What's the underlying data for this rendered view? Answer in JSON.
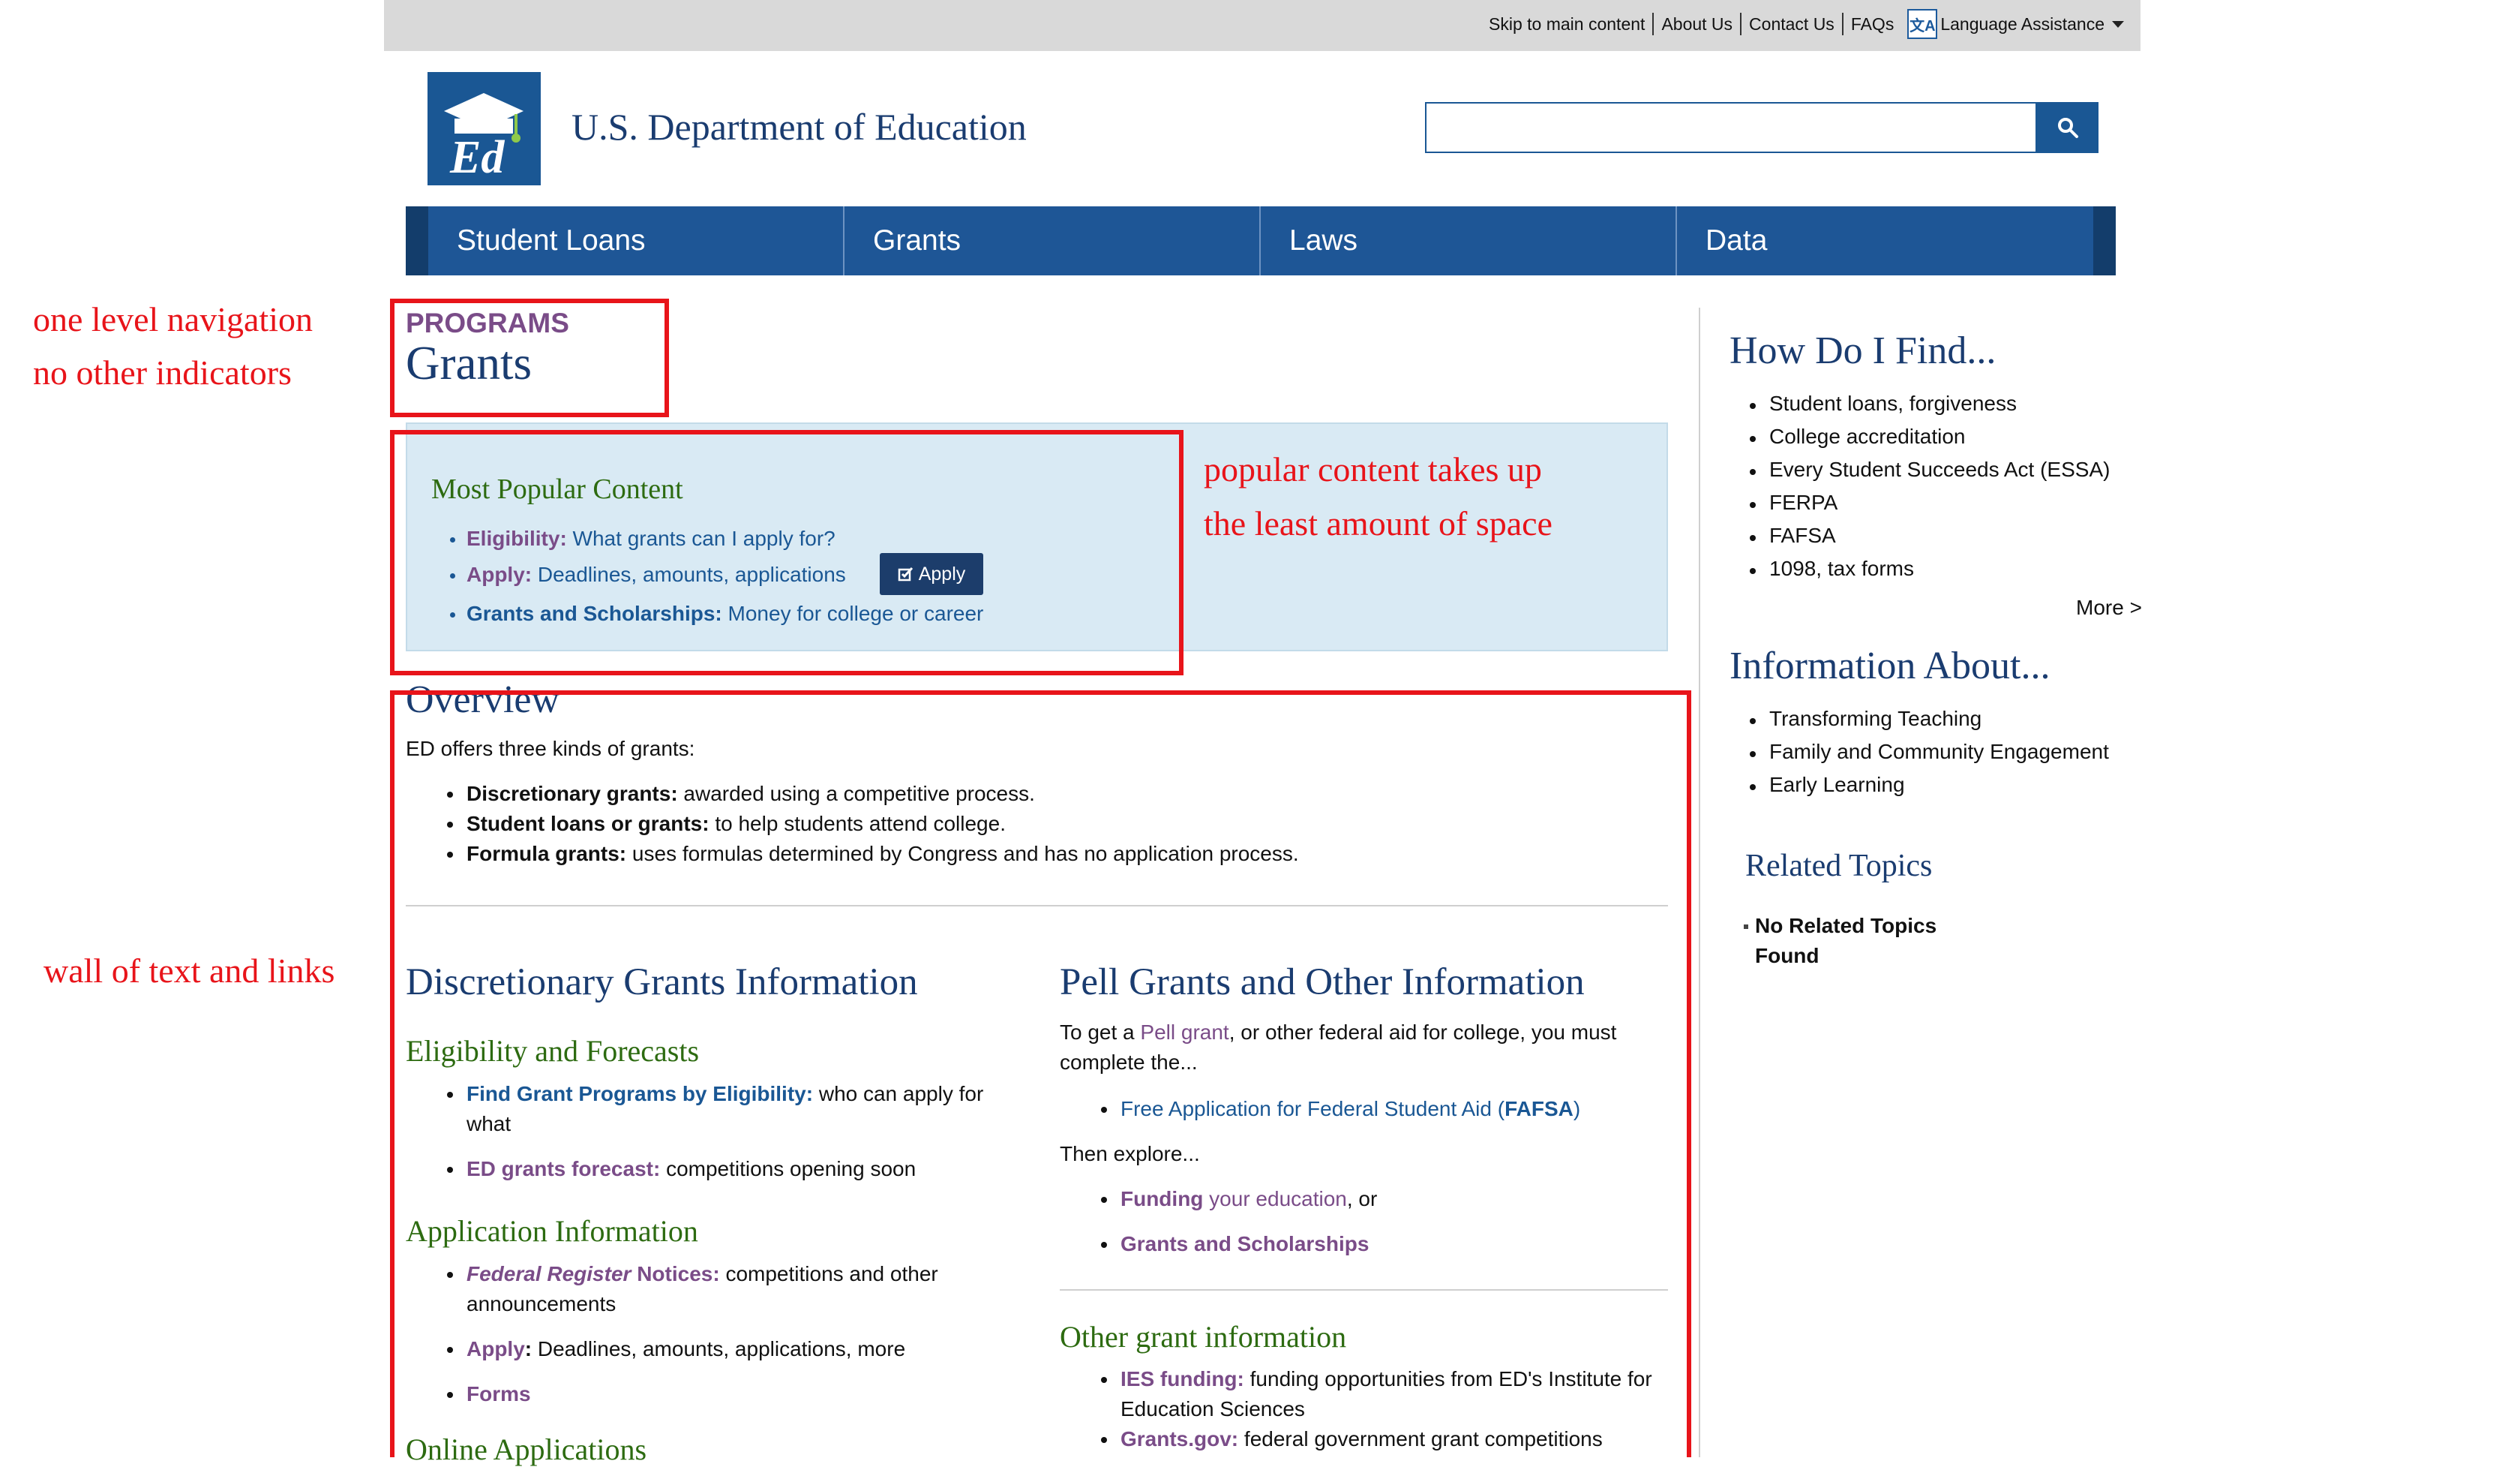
{
  "topbar": {
    "links": [
      "Skip to main content",
      "About Us",
      "Contact Us",
      "FAQs"
    ],
    "language_label": "Language Assistance"
  },
  "header": {
    "site_title": "U.S. Department of Education",
    "search_placeholder": ""
  },
  "nav": {
    "items": [
      "Student Loans",
      "Grants",
      "Laws",
      "Data"
    ]
  },
  "page": {
    "section_label": "PROGRAMS",
    "title": "Grants"
  },
  "popular": {
    "title": "Most Popular Content",
    "items": [
      {
        "label": "Eligibility:",
        "text": " What grants can I apply for?"
      },
      {
        "label": "Apply:",
        "text": " Deadlines, amounts, applications"
      },
      {
        "label": "Grants and Scholarships:",
        "text": " Money for college or career"
      }
    ],
    "apply_button": "Apply"
  },
  "overview": {
    "title": "Overview",
    "intro": "ED offers three kinds of grants:",
    "items": [
      {
        "label": "Discretionary grants:",
        "text": " awarded using a competitive process."
      },
      {
        "label": "Student loans or grants:",
        "text": " to help students attend college."
      },
      {
        "label": "Formula grants:",
        "text": " uses formulas determined by Congress and has no application process."
      }
    ]
  },
  "discretionary": {
    "title": "Discretionary Grants Information",
    "eligibility_heading": "Eligibility and Forecasts",
    "elig_item1_link": "Find Grant Programs by Eligibility:",
    "elig_item1_text_a": " who can apply for",
    "elig_item1_text_b": "what",
    "elig_item2_link": "ED grants forecast:",
    "elig_item2_text": " competitions opening soon",
    "application_heading": "Application Information",
    "app_item1_link_italic": "Federal Register",
    "app_item1_link_rest": " Notices:",
    "app_item1_text_a": " competitions and other",
    "app_item1_text_b": "announcements",
    "app_item2_link": "Apply",
    "app_item2_colon": ":",
    "app_item2_text": " Deadlines, amounts, applications, more",
    "app_item3_link": "Forms",
    "online_heading": "Online Applications"
  },
  "pell": {
    "title": "Pell Grants and Other Information",
    "intro_a1": "To get a ",
    "intro_link": "Pell grant",
    "intro_a2": ", or other federal aid for college, you must",
    "intro_b": "complete the...",
    "fafsa_text": "Free Application for Federal Student Aid (",
    "fafsa_abbr": "FAFSA",
    "fafsa_close": ")",
    "then": "Then explore...",
    "funding_bold": "Funding",
    "funding_rest": " your education",
    "funding_tail": ", or",
    "grants_schol": "Grants and Scholarships",
    "other_heading": "Other grant information",
    "ies_link": "IES funding:",
    "ies_text_a": " funding opportunities from ED's Institute for",
    "ies_text_b": "Education Sciences",
    "gov_link": "Grants.gov:",
    "gov_text": " federal government grant competitions"
  },
  "sidebar": {
    "find_title": "How Do I Find...",
    "find_items": [
      "Student loans, forgiveness",
      "College accreditation",
      "Every Student Succeeds Act (ESSA)",
      "FERPA",
      "FAFSA",
      "1098, tax forms"
    ],
    "more": "More >",
    "info_title": "Information About...",
    "info_items": [
      "Transforming Teaching",
      "Family and Community Engagement",
      "Early Learning"
    ],
    "related_title": "Related Topics",
    "related_item_a": "No Related Topics",
    "related_item_b": "Found"
  },
  "annotations": {
    "nav_note_a": "one level navigation",
    "nav_note_b": "no other indicators",
    "popular_note_a": "popular content takes up",
    "popular_note_b": "the least amount of space",
    "wall_note": "wall of text and links"
  },
  "colors": {
    "brand_blue": "#1a5794",
    "nav_blue": "#1e5696",
    "purple_link": "#7a4c88",
    "green_heading": "#2d6b11",
    "annotation_red": "#e8141a"
  }
}
